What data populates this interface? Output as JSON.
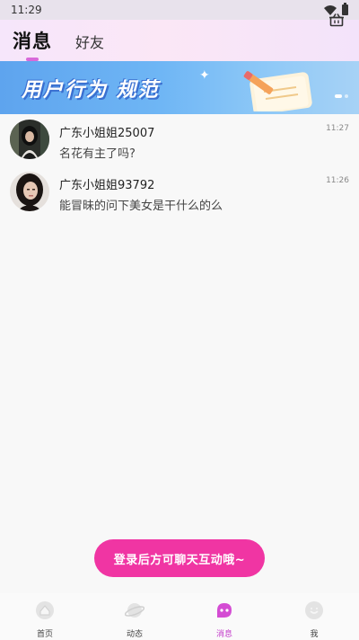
{
  "status_bar": {
    "time": "11:29"
  },
  "header": {
    "tabs": [
      {
        "label": "消息",
        "active": true
      },
      {
        "label": "好友",
        "active": false
      }
    ],
    "basket_icon": "basket-icon"
  },
  "banner": {
    "text": "用户行为 规范",
    "slide_count": 2,
    "active_slide": 1
  },
  "messages": [
    {
      "name": "广东小姐姐25007",
      "text": "名花有主了吗?",
      "time": "11:27"
    },
    {
      "name": "广东小姐姐93792",
      "text": "能冒昧的问下美女是干什么的么",
      "time": "11:26"
    }
  ],
  "login_button": {
    "label": "登录后方可聊天互动哦~"
  },
  "bottom_nav": [
    {
      "label": "首页",
      "icon": "home-icon",
      "active": false
    },
    {
      "label": "动态",
      "icon": "planet-icon",
      "active": false
    },
    {
      "label": "消息",
      "icon": "message-icon",
      "active": true
    },
    {
      "label": "我",
      "icon": "profile-icon",
      "active": false
    }
  ],
  "colors": {
    "accent": "#f035a3",
    "tab_indicator": "#d86ad9",
    "active_nav": "#c23ac9",
    "banner_blue": "#5ea4ee"
  }
}
